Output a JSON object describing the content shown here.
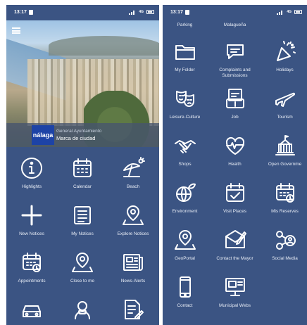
{
  "left": {
    "status": {
      "time": "13:17",
      "network": "4G"
    },
    "hero": {
      "subtitle": "General Ayuntamiento",
      "title": "Marca de ciudad",
      "logo_text": "nálaga"
    },
    "tiles": [
      {
        "label": "Highlights",
        "icon": "info-icon"
      },
      {
        "label": "Calendar",
        "icon": "calendar-icon"
      },
      {
        "label": "Beach",
        "icon": "beach-umbrella-icon"
      },
      {
        "label": "New Notices",
        "icon": "plus-icon"
      },
      {
        "label": "My Notices",
        "icon": "list-icon"
      },
      {
        "label": "Explore Notices",
        "icon": "map-pin-icon"
      },
      {
        "label": "Appointments",
        "icon": "calendar-clock-icon"
      },
      {
        "label": "Close to me",
        "icon": "map-pin-icon"
      },
      {
        "label": "News-Alerts",
        "icon": "newspaper-icon"
      },
      {
        "label": "",
        "icon": "car-icon"
      },
      {
        "label": "",
        "icon": "person-icon"
      },
      {
        "label": "",
        "icon": "document-edit-icon"
      }
    ]
  },
  "right": {
    "status": {
      "time": "13:17",
      "network": "4G"
    },
    "top_labels": [
      "Parking",
      "Malagueña",
      ""
    ],
    "tiles": [
      {
        "label": "My Folder",
        "icon": "folder-icon"
      },
      {
        "label": "Complaints and Submissions",
        "icon": "chat-bubble-icon"
      },
      {
        "label": "Holidays",
        "icon": "party-icon"
      },
      {
        "label": "Leisure-Culture",
        "icon": "theater-masks-icon"
      },
      {
        "label": "Job",
        "icon": "job-icon"
      },
      {
        "label": "Tourism",
        "icon": "airplane-icon"
      },
      {
        "label": "Shops",
        "icon": "handshake-icon"
      },
      {
        "label": "Health",
        "icon": "heartbeat-icon"
      },
      {
        "label": "Open Governme",
        "icon": "government-building-icon"
      },
      {
        "label": "Environment",
        "icon": "globe-leaf-icon"
      },
      {
        "label": "Visit Places",
        "icon": "calendar-check-icon"
      },
      {
        "label": "Mis Reserves",
        "icon": "calendar-clock-icon"
      },
      {
        "label": "GeoPortal",
        "icon": "map-pin-icon"
      },
      {
        "label": "Contact the Mayor",
        "icon": "envelope-pen-icon"
      },
      {
        "label": "Social Media",
        "icon": "share-person-icon"
      },
      {
        "label": "Contact",
        "icon": "smartphone-icon"
      },
      {
        "label": "Municipal Webs",
        "icon": "monitor-icon"
      },
      {
        "label": "",
        "icon": ""
      }
    ]
  }
}
